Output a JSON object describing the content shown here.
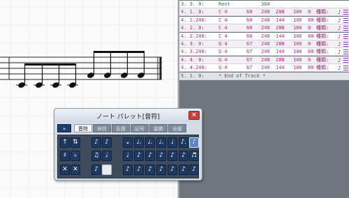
{
  "score": {
    "note_count": 8,
    "pitch_names": [
      "C4",
      "C4",
      "C4",
      "C4",
      "G4",
      "G4",
      "G4",
      "G4"
    ]
  },
  "event_list": {
    "rows": [
      {
        "time": "3. 3. 0:",
        "name": "Rest",
        "v1": "",
        "v2": "360",
        "v3": "",
        "v4": "",
        "v5": "",
        "kind": "",
        "icon": "",
        "style": "rest"
      },
      {
        "time": "4. 1. 0:",
        "name": "C 4",
        "v1": "60",
        "v2": "240",
        "v3": "288",
        "v4": "100",
        "v5": "0",
        "kind": "種類:",
        "icon": "♪",
        "style": "note"
      },
      {
        "time": "4. 1.240:",
        "name": "C 4",
        "v1": "60",
        "v2": "240",
        "v3": "144",
        "v4": "100",
        "v5": "80",
        "kind": "種類:",
        "icon": "♪",
        "style": "note"
      },
      {
        "time": "4. 2. 0:",
        "name": "C 4",
        "v1": "60",
        "v2": "240",
        "v3": "288",
        "v4": "100",
        "v5": "0",
        "kind": "種類:",
        "icon": "♪",
        "style": "note"
      },
      {
        "time": "4. 2.240:",
        "name": "C 4",
        "v1": "60",
        "v2": "240",
        "v3": "144",
        "v4": "100",
        "v5": "80",
        "kind": "種類:",
        "icon": "♪",
        "style": "note"
      },
      {
        "time": "4. 3. 0:",
        "name": "G 4",
        "v1": "67",
        "v2": "240",
        "v3": "288",
        "v4": "100",
        "v5": "0",
        "kind": "種類:",
        "icon": "♪",
        "style": "note"
      },
      {
        "time": "4. 3.240:",
        "name": "G 4",
        "v1": "67",
        "v2": "240",
        "v3": "144",
        "v4": "100",
        "v5": "80",
        "kind": "種類:",
        "icon": "♪",
        "style": "note"
      },
      {
        "time": "4. 4. 0:",
        "name": "G 4",
        "v1": "67",
        "v2": "240",
        "v3": "288",
        "v4": "100",
        "v5": "0",
        "kind": "種類:",
        "icon": "♪",
        "style": "note"
      },
      {
        "time": "4. 4.240:",
        "name": "G 4",
        "v1": "67",
        "v2": "240",
        "v3": "144",
        "v4": "100",
        "v5": "80",
        "kind": "種類:",
        "icon": "♪",
        "style": "note"
      },
      {
        "time": "5. 1. 0:",
        "name": "* End of Track *",
        "v1": "",
        "v2": "",
        "v3": "",
        "v4": "",
        "v5": "",
        "kind": "",
        "icon": "",
        "style": "eot"
      }
    ]
  },
  "palette": {
    "title": "ノート パレット[音符]",
    "close_label": "×",
    "expand_label": "»",
    "tabs": [
      "音符",
      "休符",
      "反復",
      "記号",
      "装飾",
      "全部"
    ],
    "active_tab": 0,
    "buttons": [
      [
        "↑",
        "⇅",
        "",
        "♪",
        "♪",
        "",
        "𝅝",
        "♩.",
        "♩.",
        "♩.",
        "♩",
        "♪.",
        "♪"
      ],
      [
        "♯",
        "♭",
        "",
        "♫",
        "♩",
        "",
        "♩",
        "♪",
        "♪",
        "♪",
        "♪",
        "♪",
        "♬"
      ],
      [
        "✕",
        "✕",
        "",
        "♪",
        "",
        "",
        "♪",
        "♪",
        "♪",
        "♪",
        "♪",
        "♪",
        "♪"
      ]
    ],
    "selected": [
      0,
      12
    ],
    "blank": [
      [
        2,
        2
      ],
      [
        2,
        4
      ]
    ]
  }
}
